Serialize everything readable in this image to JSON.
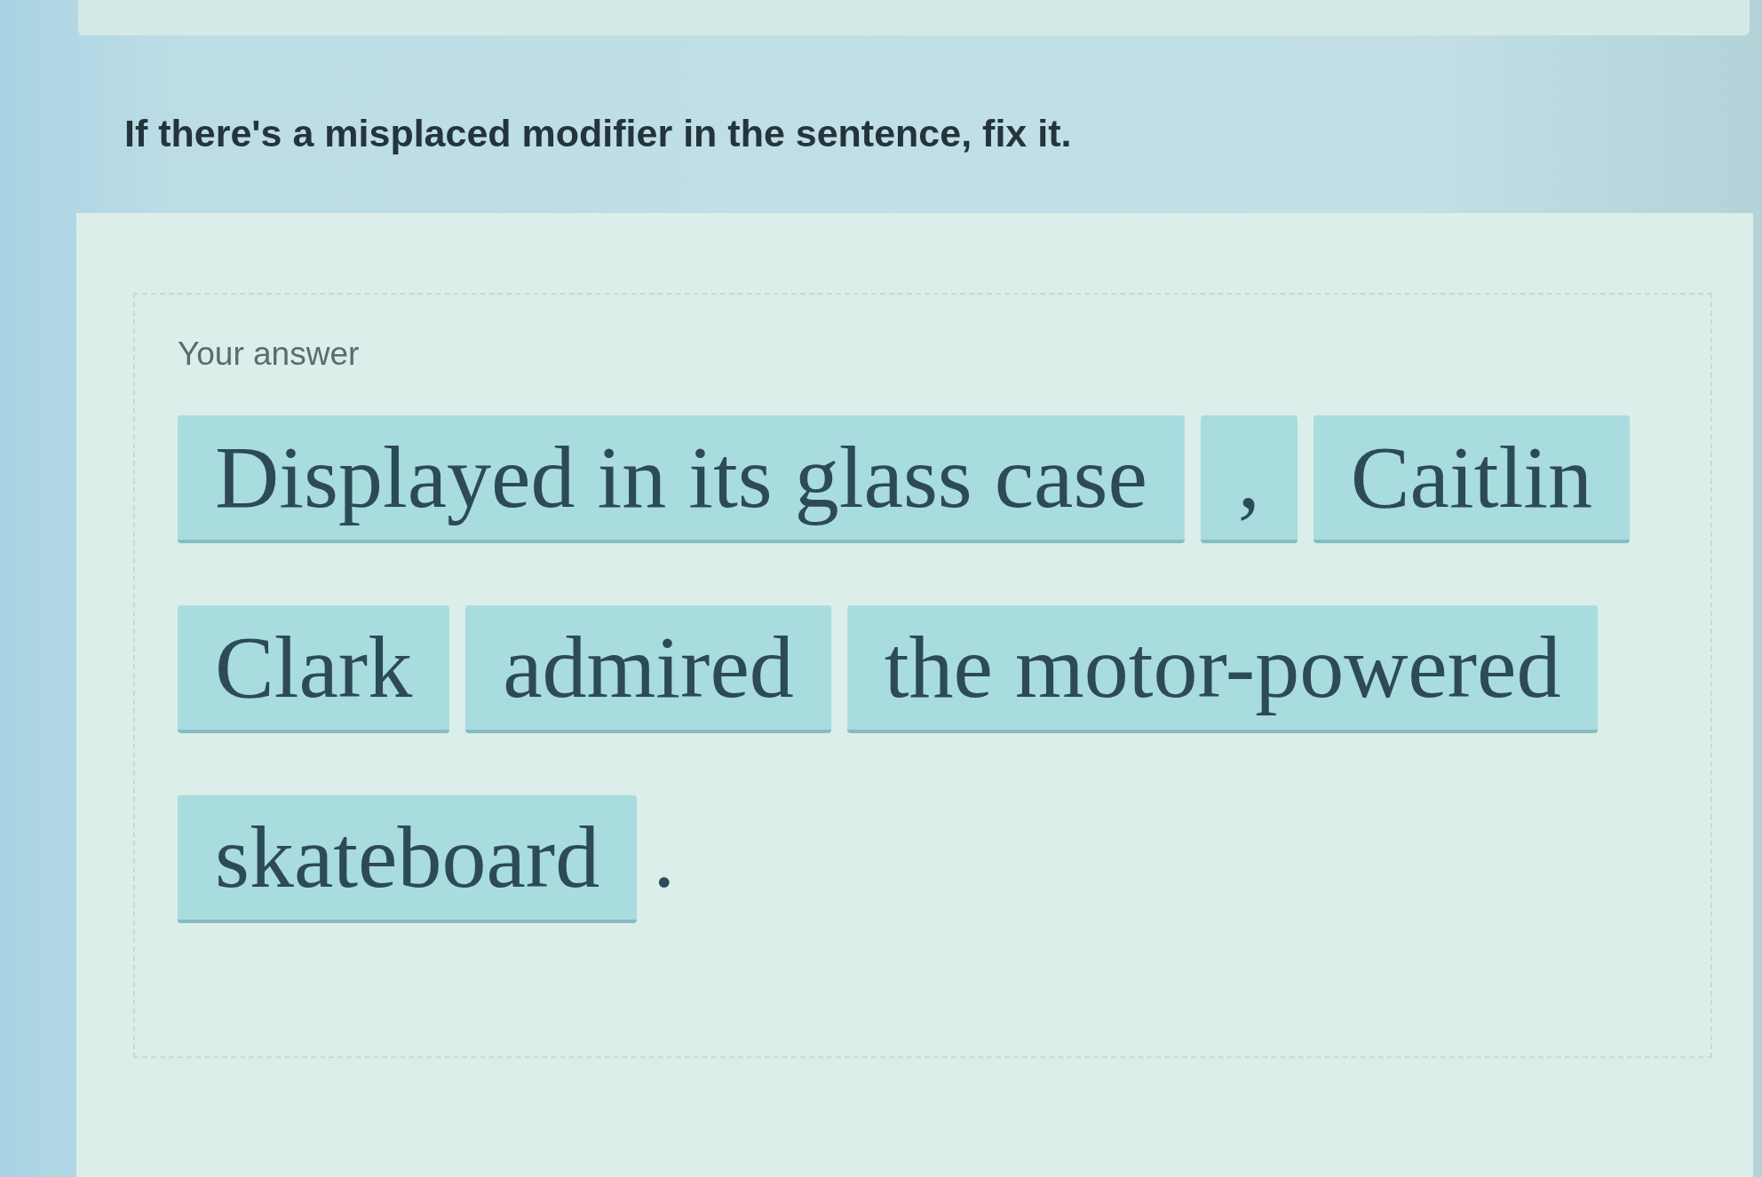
{
  "instruction": "If there's a misplaced modifier in the sentence, fix it.",
  "answer": {
    "label": "Your answer",
    "items": [
      {
        "kind": "tile",
        "text": "Displayed in its glass case"
      },
      {
        "kind": "tile",
        "text": ","
      },
      {
        "kind": "tile",
        "text": "Caitlin"
      },
      {
        "kind": "tile",
        "text": "Clark"
      },
      {
        "kind": "tile",
        "text": "admired"
      },
      {
        "kind": "tile",
        "text": "the motor-powered"
      },
      {
        "kind": "tile",
        "text": "skateboard"
      },
      {
        "kind": "text",
        "text": "."
      }
    ]
  }
}
